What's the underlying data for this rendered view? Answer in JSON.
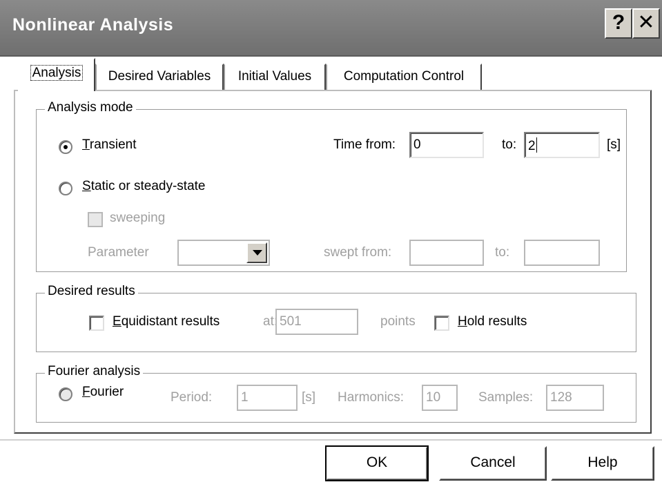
{
  "window": {
    "title": "Nonlinear Analysis",
    "help_glyph": "?",
    "close_glyph": "✕"
  },
  "tabs": [
    {
      "label": "Analysis",
      "active": true
    },
    {
      "label": "Desired Variables",
      "active": false
    },
    {
      "label": "Initial Values",
      "active": false
    },
    {
      "label": "Computation Control",
      "active": false
    }
  ],
  "analysis_mode": {
    "group_label": "Analysis mode",
    "transient_label": "Transient",
    "transient_selected": true,
    "time_from_label": "Time from:",
    "time_from_value": "0",
    "to_label": "to:",
    "to_value": "2",
    "unit": "[s]",
    "static_label": "Static or steady-state",
    "static_selected": false,
    "sweeping_label": "sweeping",
    "parameter_label": "Parameter",
    "parameter_value": "",
    "swept_from_label": "swept from:",
    "swept_from_value": "",
    "swept_to_label": "to:",
    "swept_to_value": ""
  },
  "desired_results": {
    "group_label": "Desired results",
    "equidistant_label": "Equidistant results",
    "at_label": "at:",
    "points_value": "501",
    "points_label": "points",
    "hold_label": "Hold results"
  },
  "fourier": {
    "group_label": "Fourier analysis",
    "fourier_label": "Fourier",
    "period_label": "Period:",
    "period_value": "1",
    "period_unit": "[s]",
    "harmonics_label": "Harmonics:",
    "harmonics_value": "10",
    "samples_label": "Samples:",
    "samples_value": "128"
  },
  "buttons": {
    "ok": "OK",
    "cancel": "Cancel",
    "help": "Help"
  }
}
